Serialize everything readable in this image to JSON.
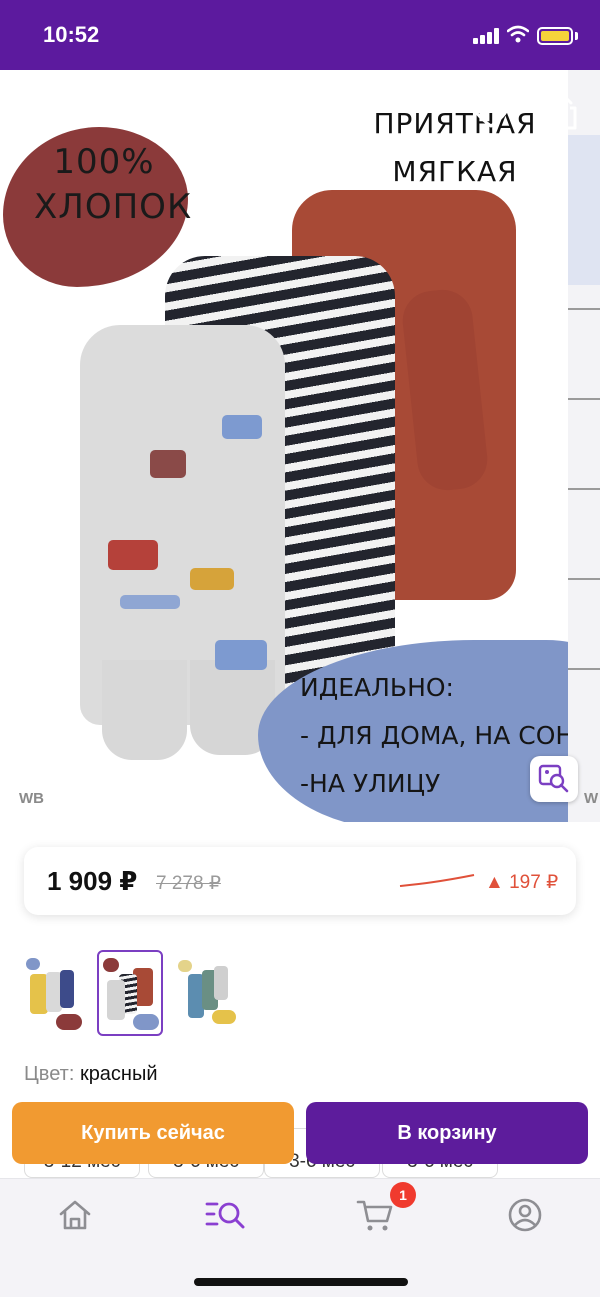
{
  "status_bar": {
    "time": "10:52"
  },
  "gallery": {
    "badge_cotton": "100% ХЛОПОК",
    "headline": "ПРИЯТНАЯ МЯГКАЯ ТКАНЬ",
    "usage_lines": [
      "ИДЕАЛЬНО:",
      "- ДЛЯ ДОМА, НА СОН",
      "-НА УЛИЦУ"
    ],
    "watermark": "WB",
    "next_watermark": "W"
  },
  "price": {
    "current": "1 909 ₽",
    "old": "7 278 ₽",
    "change": "▲ 197 ₽",
    "change_color": "#e0513a"
  },
  "color": {
    "label": "Цвет:",
    "value": "красный"
  },
  "sizes": [
    "3-12 мес",
    "3-6 мес",
    "3-6 мес",
    "3-6 мес"
  ],
  "actions": {
    "buy_now": "Купить сейчас",
    "add_to_cart": "В корзину"
  },
  "tab_bar": {
    "items": [
      "home-icon",
      "search-icon",
      "cart-icon",
      "profile-icon"
    ],
    "active": "search-icon",
    "cart_count": "1"
  },
  "colors": {
    "brand_purple": "#5c1a9e",
    "buy_orange": "#f19a31",
    "active_tab": "#8a3fd1"
  }
}
